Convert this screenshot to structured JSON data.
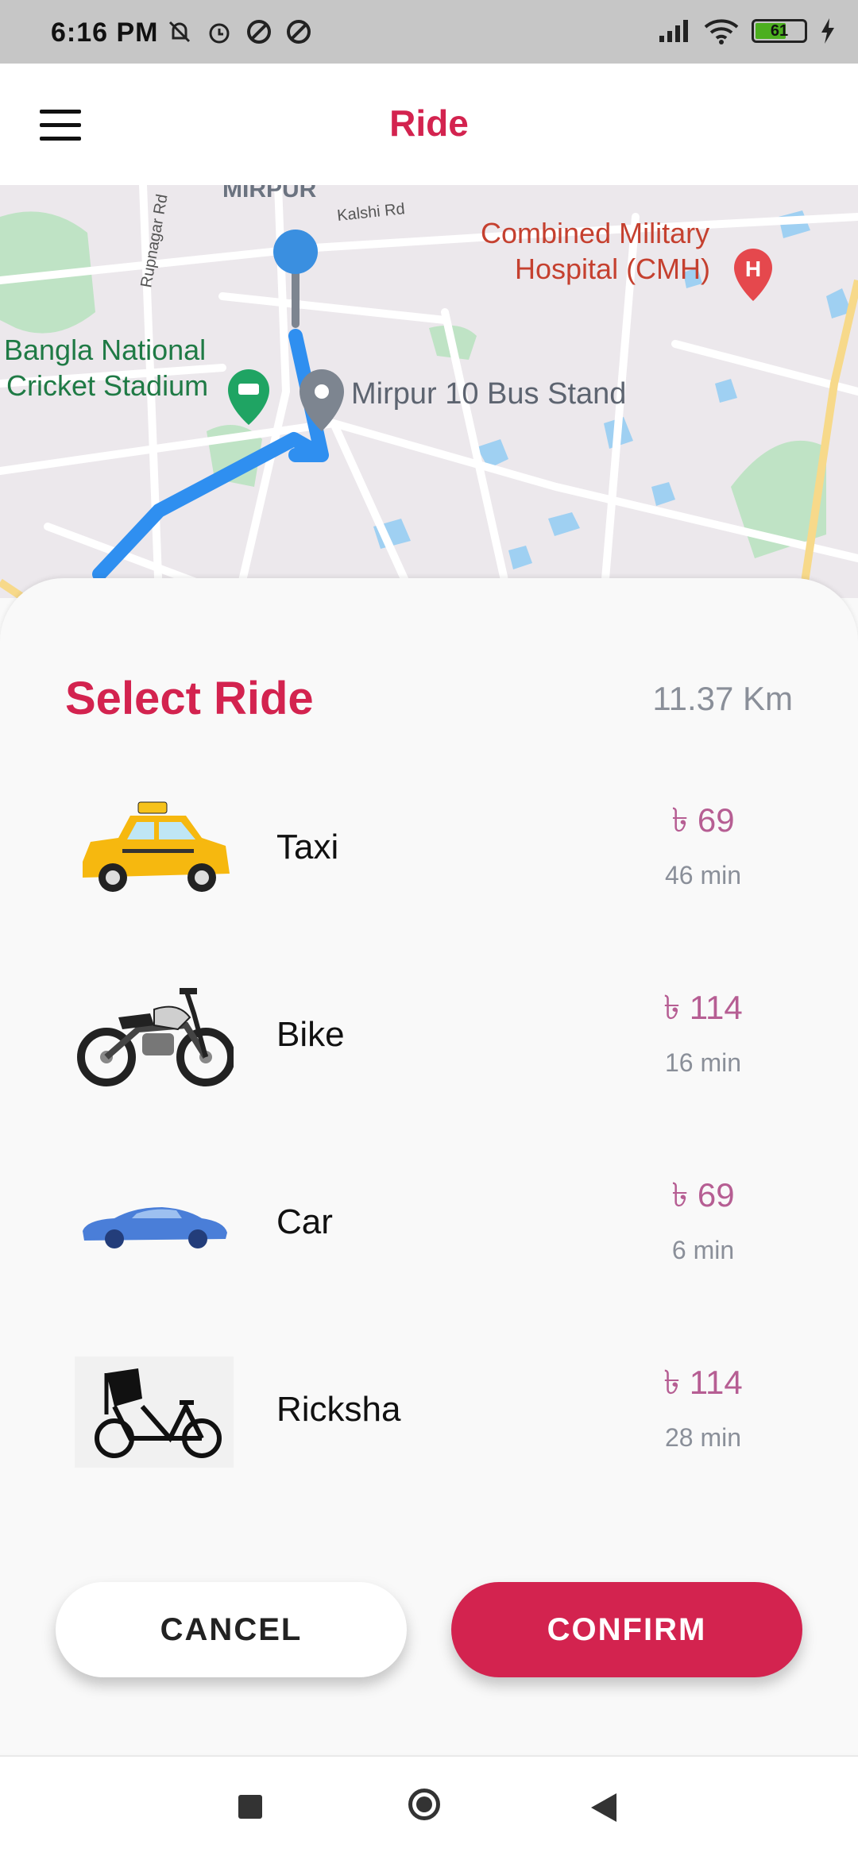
{
  "status_bar": {
    "time": "6:16 PM",
    "battery": "61"
  },
  "app_bar": {
    "title": "Ride"
  },
  "map": {
    "labels": {
      "area": "MIRPUR",
      "road1": "Kalshi Rd",
      "road2": "Rupnagar Rd",
      "hospital_line1": "Combined Military",
      "hospital_line2": "Hospital (CMH)",
      "stadium_line1": "Bangla National",
      "stadium_line2": "Cricket Stadium",
      "bus_stand": "Mirpur 10 Bus Stand"
    }
  },
  "sheet": {
    "title": "Select Ride",
    "distance": "11.37 Km"
  },
  "rides": [
    {
      "name": "Taxi",
      "fare": "৳ 69",
      "eta": "46 min",
      "icon": "taxi-icon"
    },
    {
      "name": "Bike",
      "fare": "৳ 114",
      "eta": "16 min",
      "icon": "motorbike-icon"
    },
    {
      "name": "Car",
      "fare": "৳ 69",
      "eta": "6 min",
      "icon": "car-icon"
    },
    {
      "name": "Ricksha",
      "fare": "৳ 114",
      "eta": "28 min",
      "icon": "rickshaw-icon"
    }
  ],
  "buttons": {
    "cancel": "CANCEL",
    "confirm": "CONFIRM"
  },
  "colors": {
    "accent": "#d3234f",
    "fare": "#b65e93",
    "route": "#2f8ff0"
  }
}
